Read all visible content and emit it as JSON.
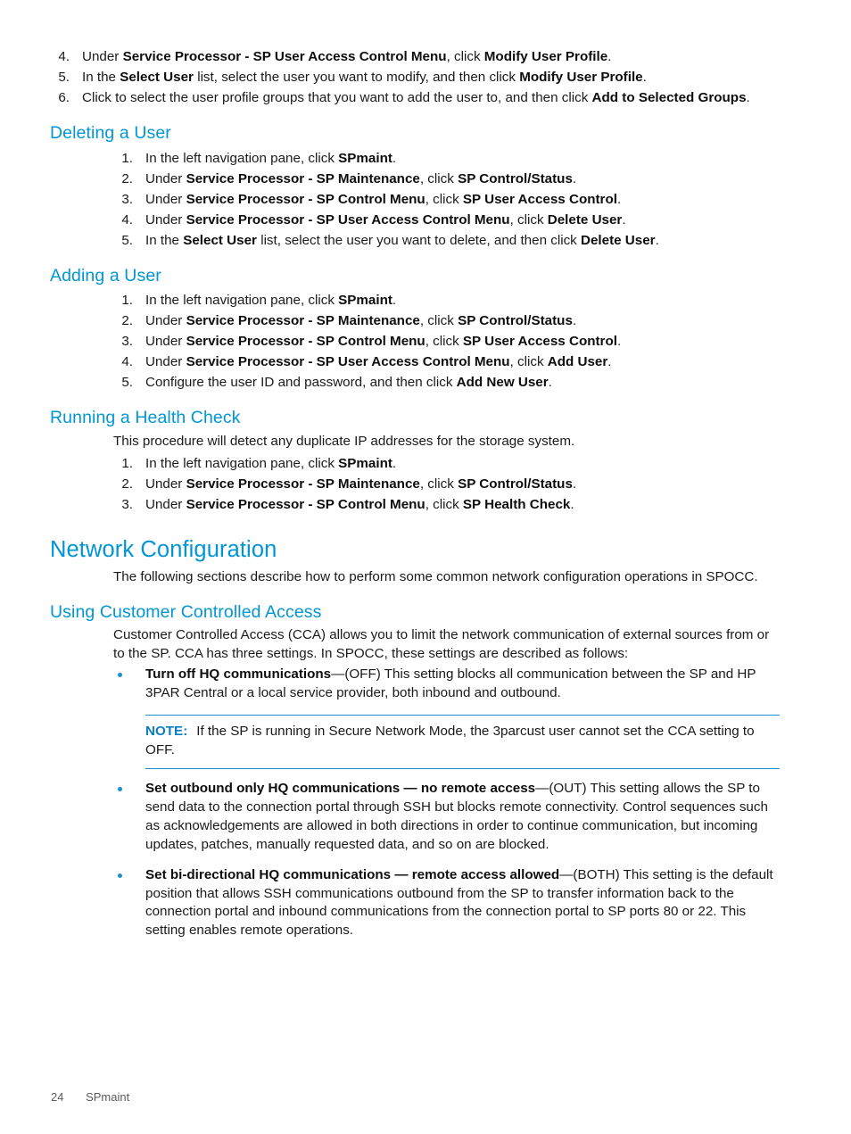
{
  "page": {
    "footer_page_number": "24",
    "footer_chapter": "SPmaint",
    "accent_color": "#0096d6",
    "rule_color": "#1d8fd1"
  },
  "top_steps": [
    {
      "num": "4.",
      "parts": [
        {
          "t": "Under ",
          "b": false
        },
        {
          "t": "Service Processor - SP User Access Control Menu",
          "b": true
        },
        {
          "t": ", click ",
          "b": false
        },
        {
          "t": "Modify User Profile",
          "b": true
        },
        {
          "t": ".",
          "b": false
        }
      ]
    },
    {
      "num": "5.",
      "parts": [
        {
          "t": "In the ",
          "b": false
        },
        {
          "t": "Select User",
          "b": true
        },
        {
          "t": " list, select the user you want to modify, and then click ",
          "b": false
        },
        {
          "t": "Modify User Profile",
          "b": true
        },
        {
          "t": ".",
          "b": false
        }
      ]
    },
    {
      "num": "6.",
      "parts": [
        {
          "t": "Click to select the user profile groups that you want to add the user to, and then click ",
          "b": false
        },
        {
          "t": "Add to Selected Groups",
          "b": true
        },
        {
          "t": ".",
          "b": false
        }
      ]
    }
  ],
  "sections": [
    {
      "id": "deleting-a-user",
      "level": "h2",
      "title": "Deleting a User",
      "intro": null,
      "steps": [
        {
          "num": "1.",
          "parts": [
            {
              "t": "In the left navigation pane, click ",
              "b": false
            },
            {
              "t": "SPmaint",
              "b": true
            },
            {
              "t": ".",
              "b": false
            }
          ]
        },
        {
          "num": "2.",
          "parts": [
            {
              "t": "Under ",
              "b": false
            },
            {
              "t": "Service Processor - SP Maintenance",
              "b": true
            },
            {
              "t": ", click ",
              "b": false
            },
            {
              "t": "SP Control/Status",
              "b": true
            },
            {
              "t": ".",
              "b": false
            }
          ]
        },
        {
          "num": "3.",
          "parts": [
            {
              "t": "Under ",
              "b": false
            },
            {
              "t": "Service Processor - SP Control Menu",
              "b": true
            },
            {
              "t": ", click ",
              "b": false
            },
            {
              "t": "SP User Access Control",
              "b": true
            },
            {
              "t": ".",
              "b": false
            }
          ]
        },
        {
          "num": "4.",
          "parts": [
            {
              "t": "Under ",
              "b": false
            },
            {
              "t": "Service Processor - SP User Access Control Menu",
              "b": true
            },
            {
              "t": ", click ",
              "b": false
            },
            {
              "t": "Delete User",
              "b": true
            },
            {
              "t": ".",
              "b": false
            }
          ]
        },
        {
          "num": "5.",
          "parts": [
            {
              "t": "In the ",
              "b": false
            },
            {
              "t": "Select User",
              "b": true
            },
            {
              "t": " list, select the user you want to delete, and then click ",
              "b": false
            },
            {
              "t": "Delete User",
              "b": true
            },
            {
              "t": ".",
              "b": false
            }
          ]
        }
      ]
    },
    {
      "id": "adding-a-user",
      "level": "h2",
      "title": "Adding a User",
      "intro": null,
      "steps": [
        {
          "num": "1.",
          "parts": [
            {
              "t": "In the left navigation pane, click ",
              "b": false
            },
            {
              "t": "SPmaint",
              "b": true
            },
            {
              "t": ".",
              "b": false
            }
          ]
        },
        {
          "num": "2.",
          "parts": [
            {
              "t": "Under ",
              "b": false
            },
            {
              "t": "Service Processor - SP Maintenance",
              "b": true
            },
            {
              "t": ", click ",
              "b": false
            },
            {
              "t": "SP Control/Status",
              "b": true
            },
            {
              "t": ".",
              "b": false
            }
          ]
        },
        {
          "num": "3.",
          "parts": [
            {
              "t": "Under ",
              "b": false
            },
            {
              "t": "Service Processor - SP Control Menu",
              "b": true
            },
            {
              "t": ", click ",
              "b": false
            },
            {
              "t": "SP User Access Control",
              "b": true
            },
            {
              "t": ".",
              "b": false
            }
          ]
        },
        {
          "num": "4.",
          "parts": [
            {
              "t": "Under ",
              "b": false
            },
            {
              "t": "Service Processor - SP User Access Control Menu",
              "b": true
            },
            {
              "t": ", click ",
              "b": false
            },
            {
              "t": "Add User",
              "b": true
            },
            {
              "t": ".",
              "b": false
            }
          ]
        },
        {
          "num": "5.",
          "parts": [
            {
              "t": "Configure the user ID and password, and then click ",
              "b": false
            },
            {
              "t": "Add New User",
              "b": true
            },
            {
              "t": ".",
              "b": false
            }
          ]
        }
      ]
    },
    {
      "id": "running-a-health-check",
      "level": "h2",
      "title": "Running a Health Check",
      "intro": "This procedure will detect any duplicate IP addresses for the storage system.",
      "steps": [
        {
          "num": "1.",
          "parts": [
            {
              "t": "In the left navigation pane, click ",
              "b": false
            },
            {
              "t": "SPmaint",
              "b": true
            },
            {
              "t": ".",
              "b": false
            }
          ]
        },
        {
          "num": "2.",
          "parts": [
            {
              "t": "Under ",
              "b": false
            },
            {
              "t": "Service Processor - SP Maintenance",
              "b": true
            },
            {
              "t": ", click ",
              "b": false
            },
            {
              "t": "SP Control/Status",
              "b": true
            },
            {
              "t": ".",
              "b": false
            }
          ]
        },
        {
          "num": "3.",
          "parts": [
            {
              "t": "Under ",
              "b": false
            },
            {
              "t": "Service Processor - SP Control Menu",
              "b": true
            },
            {
              "t": ", click ",
              "b": false
            },
            {
              "t": "SP Health Check",
              "b": true
            },
            {
              "t": ".",
              "b": false
            }
          ]
        }
      ]
    }
  ],
  "network_section": {
    "title": "Network Configuration",
    "intro": "The following sections describe how to perform some common network configuration operations in SPOCC."
  },
  "cca_section": {
    "title": "Using Customer Controlled Access",
    "intro": "Customer Controlled Access (CCA) allows you to limit the network communication of external sources from or to the SP. CCA has three settings. In SPOCC, these settings are described as follows:",
    "bullets": [
      {
        "parts": [
          {
            "t": "Turn off HQ communications",
            "b": true
          },
          {
            "t": "—(OFF) This setting blocks all communication between the SP and HP 3PAR Central or a local service provider, both inbound and outbound.",
            "b": false
          }
        ]
      },
      {
        "parts": [
          {
            "t": "Set outbound only HQ communications — no remote access",
            "b": true
          },
          {
            "t": "—(OUT) This setting allows the SP to send data to the connection portal through SSH but blocks remote connectivity. Control sequences such as acknowledgements are allowed in both directions in order to continue communication, but incoming updates, patches, manually requested data, and so on are blocked.",
            "b": false
          }
        ]
      },
      {
        "parts": [
          {
            "t": "Set bi-directional HQ communications — remote access allowed",
            "b": true
          },
          {
            "t": "—(BOTH) This setting is the default position that allows SSH communications outbound from the SP to transfer information back to the connection portal and inbound communications from the connection portal to SP ports 80 or 22. This setting enables remote operations.",
            "b": false
          }
        ]
      }
    ],
    "note": {
      "label": "NOTE:",
      "text": "If the SP is running in Secure Network Mode, the 3parcust user cannot set the CCA setting to OFF."
    }
  }
}
